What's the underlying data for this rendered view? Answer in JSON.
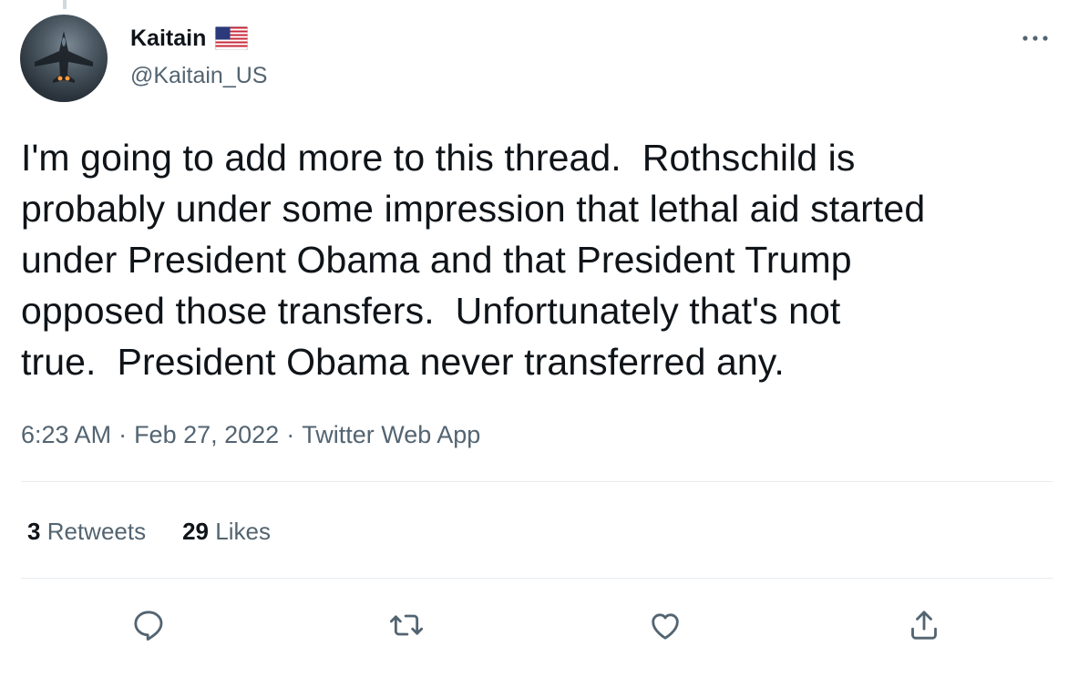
{
  "author": {
    "display_name": "Kaitain",
    "handle": "@Kaitain_US",
    "flag_icon": "us-flag-icon"
  },
  "tweet": {
    "text": "I'm going to add more to this thread.  Rothschild is\nprobably under some impression that lethal aid started\nunder President Obama and that President Trump\nopposed those transfers.  Unfortunately that's not\ntrue.  President Obama never transferred any.",
    "time": "6:23 AM",
    "date": "Feb 27, 2022",
    "source": "Twitter Web App",
    "separator": "·"
  },
  "stats": {
    "retweets_count": "3",
    "retweets_label": "Retweets",
    "likes_count": "29",
    "likes_label": "Likes"
  },
  "actions": [
    "reply-icon",
    "retweet-icon",
    "like-icon",
    "share-icon"
  ],
  "colors": {
    "text": "#0f1419",
    "secondary": "#536471",
    "divider": "#e7ecef"
  }
}
